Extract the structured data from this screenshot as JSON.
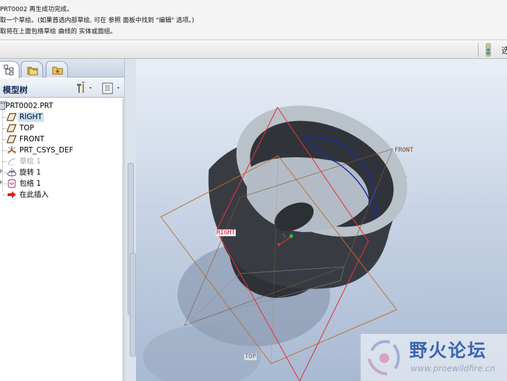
{
  "messages": [
    "PRT0002 再生成功完成。",
    "取一个草绘。(如果首选内部草绘, 可在 参照 面板中找到 \"编辑\" 选项。)",
    "取将在上面包络草绘 曲线的 实体或面组。"
  ],
  "status": {
    "light": "green",
    "text": "选"
  },
  "tabs": [
    {
      "name": "model-tree-tab",
      "icon": "model-tree-icon",
      "active": true
    },
    {
      "name": "folder-browser-tab",
      "icon": "folder-icon",
      "active": false
    },
    {
      "name": "favorites-tab",
      "icon": "favorites-icon",
      "active": false
    }
  ],
  "tree": {
    "title": "模型树",
    "items": [
      {
        "label": "PRT0002.PRT",
        "icon": "part-icon"
      },
      {
        "label": "RIGHT",
        "icon": "datum-plane-icon",
        "selected": true
      },
      {
        "label": "TOP",
        "icon": "datum-plane-icon"
      },
      {
        "label": "FRONT",
        "icon": "datum-plane-icon"
      },
      {
        "label": "PRT_CSYS_DEF",
        "icon": "csys-icon"
      },
      {
        "label": "草绘 1",
        "icon": "sketch-icon",
        "greyed": true
      },
      {
        "label": "旋转 1",
        "icon": "revolve-icon",
        "expandable": true
      },
      {
        "label": "包络 1",
        "icon": "wrap-icon",
        "expandable": true
      },
      {
        "label": "在此插入",
        "icon": "insert-here-icon"
      }
    ]
  },
  "viewport": {
    "datum_labels": {
      "front": "FRONT",
      "right": "RIGHT",
      "top": "TOP"
    },
    "colors": {
      "model": "#3a3f45",
      "model_face": "#b7bfc7",
      "right_plane": "#e8303d",
      "top_plane": "#b8722f",
      "wrap_curve": "#1a2aa8"
    }
  },
  "watermark": {
    "title": "野火论坛",
    "url": "www.proewildfire.cn"
  }
}
